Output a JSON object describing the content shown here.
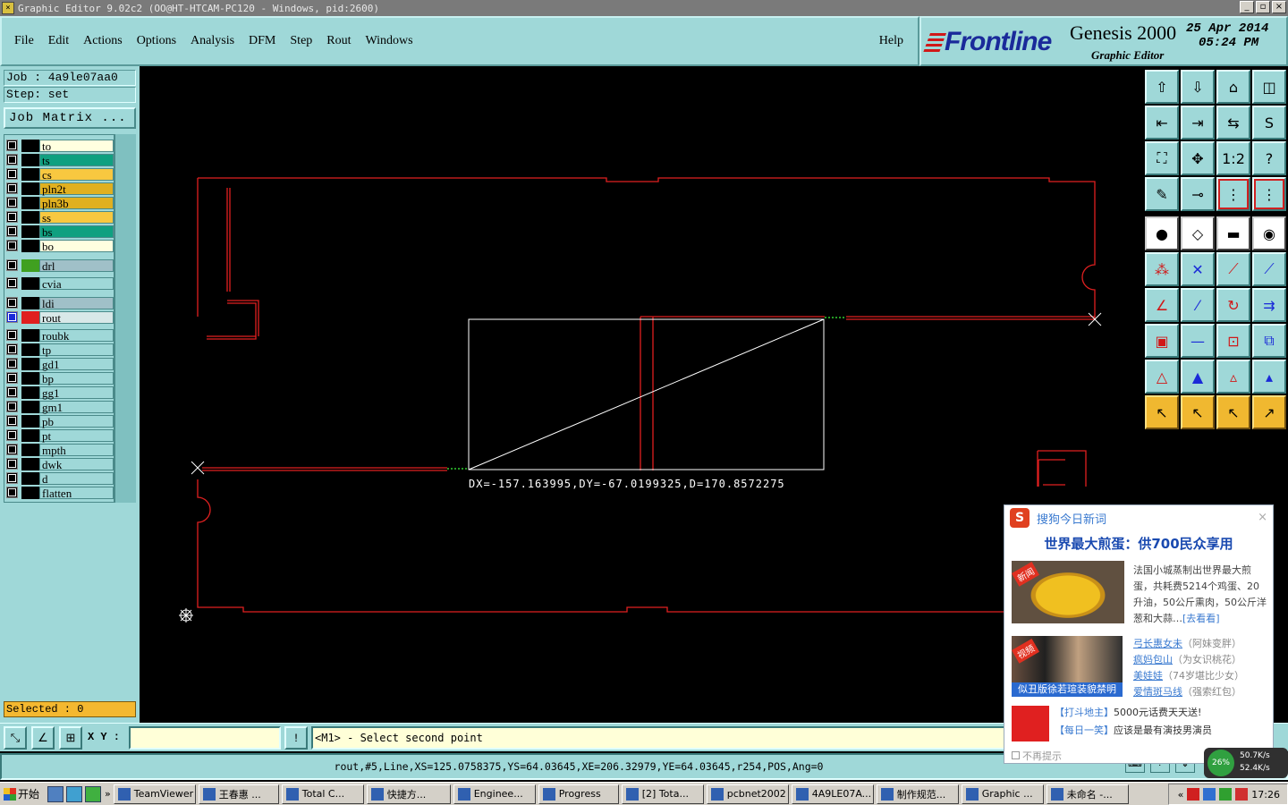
{
  "titlebar": {
    "title": "Graphic Editor 9.02c2 (OO@HT-HTCAM-PC120 - Windows, pid:2600)",
    "btn_min": "_",
    "btn_max": "▫",
    "btn_close": "×"
  },
  "menu": {
    "items": [
      "File",
      "Edit",
      "Actions",
      "Options",
      "Analysis",
      "DFM",
      "Step",
      "Rout",
      "Windows"
    ],
    "help": "Help"
  },
  "brand": {
    "logo": "Frontline",
    "product": "Genesis 2000",
    "subtitle": "Graphic Editor",
    "date": "25 Apr 2014",
    "time": "05:24 PM"
  },
  "job": {
    "job_label": "Job : 4a9le07aa0",
    "step_label": "Step: set",
    "matrix_button": "Job Matrix ..."
  },
  "layers": [
    {
      "name": "to",
      "color": "#ffffe0"
    },
    {
      "name": "ts",
      "color": "#10a080"
    },
    {
      "name": "cs",
      "color": "#f8c840"
    },
    {
      "name": "pln2t",
      "color": "#e0b020"
    },
    {
      "name": "pln3b",
      "color": "#e0b020"
    },
    {
      "name": "ss",
      "color": "#f8c840"
    },
    {
      "name": "bs",
      "color": "#10a080"
    },
    {
      "name": "bo",
      "color": "#ffffe0"
    },
    {
      "name": "drl",
      "color": "#a0c0c8",
      "swatch": "#40a020"
    },
    {
      "name": "cvia",
      "color": "#9fd8d8"
    },
    {
      "name": "ldi",
      "color": "#a0c0c8"
    },
    {
      "name": "rout",
      "color": "#d8e8e8",
      "swatch": "#e02020",
      "active": true
    },
    {
      "name": "roubk",
      "color": "#9fd8d8"
    },
    {
      "name": "tp",
      "color": "#9fd8d8"
    },
    {
      "name": "gd1",
      "color": "#9fd8d8"
    },
    {
      "name": "bp",
      "color": "#9fd8d8"
    },
    {
      "name": "gg1",
      "color": "#9fd8d8"
    },
    {
      "name": "gm1",
      "color": "#9fd8d8"
    },
    {
      "name": "pb",
      "color": "#9fd8d8"
    },
    {
      "name": "pt",
      "color": "#9fd8d8"
    },
    {
      "name": "mpth",
      "color": "#9fd8d8"
    },
    {
      "name": "dwk",
      "color": "#9fd8d8"
    },
    {
      "name": "d",
      "color": "#9fd8d8"
    },
    {
      "name": "flatten",
      "color": "#9fd8d8"
    }
  ],
  "selected": "Selected : 0",
  "measure": "DX=-157.163995,DY=-67.0199325,D=170.8572275",
  "cmd": {
    "xy_label": "X Y :",
    "xy_value": "",
    "info_btn": "!",
    "prompt": "<M1> - Select second point"
  },
  "status": "rout,#5,Line,XS=125.0758375,YS=64.03645,XE=206.32979,YE=64.03645,r254,POS,Ang=0",
  "popup": {
    "app": "搜狗今日新词",
    "close": "×",
    "headline": "世界最大煎蛋：供700民众享用",
    "story_badge": "新闻",
    "story_text": "法国小城蒸制出世界最大煎蛋，共耗费5214个鸡蛋、20升油，50公斤熏肉，50公斤洋葱和大蒜…",
    "story_more": "[去看看]",
    "img2_badge": "视频",
    "img2_caption": "似丑版徐若瑄装貌禁明",
    "links": [
      {
        "title": "弓长惠女未",
        "note": "（阿妹变胖）"
      },
      {
        "title": "疯妈包山",
        "note": "（为女识桃花）"
      },
      {
        "title": "美娃娃",
        "note": "（74岁堪比少女）"
      },
      {
        "title": "爱情斑马线",
        "note": "（强索红包）"
      }
    ],
    "promo1_tag": "【打斗地主】",
    "promo1_text": "5000元话费天天送!",
    "promo2_tag": "【每日一笑】",
    "promo2_text": "应该是最有演技男演员",
    "no_remind": "不再提示"
  },
  "netmon": {
    "percent": "26%",
    "up": "50.7K/s",
    "down": "52.4K/s"
  },
  "taskbar": {
    "start": "开始",
    "tasks": [
      "TeamViewer",
      "王春惠 ...",
      "Total C...",
      "快捷方...",
      "Enginee...",
      "Progress",
      "[2] Tota...",
      "pcbnet2002",
      "4A9LE07A...",
      "制作规范...",
      "Graphic ...",
      "未命名 -..."
    ],
    "more": "«",
    "clock": "17:26"
  }
}
